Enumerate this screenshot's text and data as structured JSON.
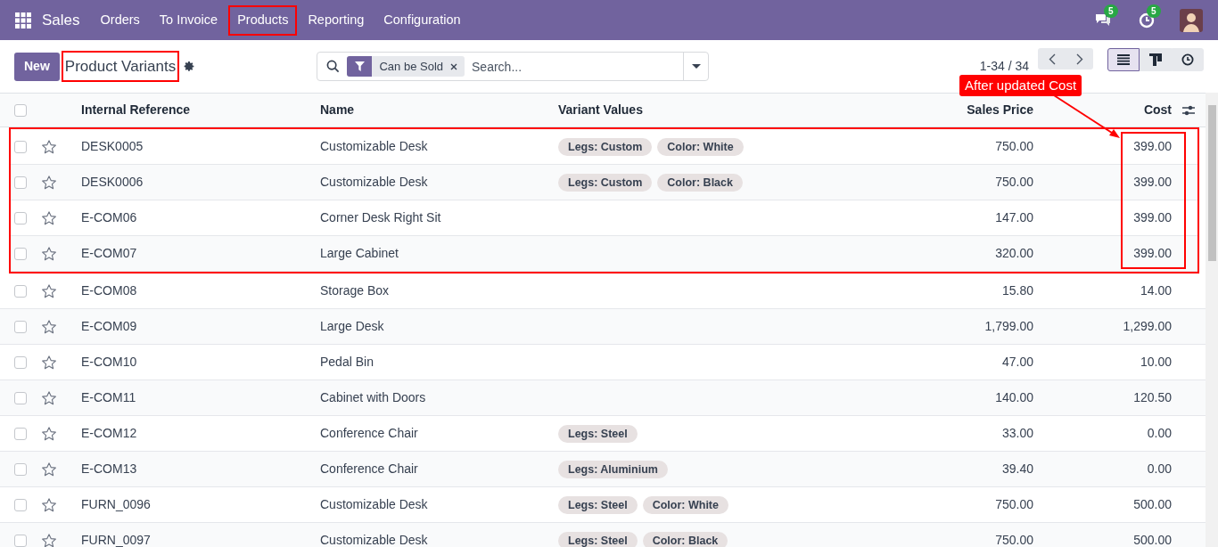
{
  "topbar": {
    "app": "Sales",
    "menu": [
      {
        "label": "Orders",
        "highlighted": false
      },
      {
        "label": "To Invoice",
        "highlighted": false
      },
      {
        "label": "Products",
        "highlighted": true
      },
      {
        "label": "Reporting",
        "highlighted": false
      },
      {
        "label": "Configuration",
        "highlighted": false
      }
    ],
    "messages_badge": "5",
    "activities_badge": "5"
  },
  "control_panel": {
    "new_button": "New",
    "title": "Product Variants",
    "title_highlighted": true,
    "search": {
      "facet": "Can be Sold",
      "placeholder": "Search..."
    },
    "pager": "1-34 / 34",
    "views": [
      {
        "kind": "list",
        "selected": true
      },
      {
        "kind": "kanban",
        "selected": false
      },
      {
        "kind": "activity",
        "selected": false
      }
    ]
  },
  "annotation": {
    "callout": "After updated Cost"
  },
  "table": {
    "select_all_checked": false,
    "columns": [
      "Internal Reference",
      "Name",
      "Variant Values",
      "Sales Price",
      "Cost"
    ],
    "rows": [
      {
        "ref": "DESK0005",
        "name": "Customizable Desk",
        "variants": [
          "Legs: Custom",
          "Color: White"
        ],
        "sales_price": "750.00",
        "cost": "399.00",
        "highlighted": true,
        "checked": false,
        "starred": false
      },
      {
        "ref": "DESK0006",
        "name": "Customizable Desk",
        "variants": [
          "Legs: Custom",
          "Color: Black"
        ],
        "sales_price": "750.00",
        "cost": "399.00",
        "highlighted": true,
        "checked": false,
        "starred": false
      },
      {
        "ref": "E-COM06",
        "name": "Corner Desk Right Sit",
        "variants": [],
        "sales_price": "147.00",
        "cost": "399.00",
        "highlighted": true,
        "checked": false,
        "starred": false
      },
      {
        "ref": "E-COM07",
        "name": "Large Cabinet",
        "variants": [],
        "sales_price": "320.00",
        "cost": "399.00",
        "highlighted": true,
        "checked": false,
        "starred": false
      },
      {
        "ref": "E-COM08",
        "name": "Storage Box",
        "variants": [],
        "sales_price": "15.80",
        "cost": "14.00",
        "highlighted": false,
        "checked": false,
        "starred": false
      },
      {
        "ref": "E-COM09",
        "name": "Large Desk",
        "variants": [],
        "sales_price": "1,799.00",
        "cost": "1,299.00",
        "highlighted": false,
        "checked": false,
        "starred": false
      },
      {
        "ref": "E-COM10",
        "name": "Pedal Bin",
        "variants": [],
        "sales_price": "47.00",
        "cost": "10.00",
        "highlighted": false,
        "checked": false,
        "starred": false
      },
      {
        "ref": "E-COM11",
        "name": "Cabinet with Doors",
        "variants": [],
        "sales_price": "140.00",
        "cost": "120.50",
        "highlighted": false,
        "checked": false,
        "starred": false
      },
      {
        "ref": "E-COM12",
        "name": "Conference Chair",
        "variants": [
          "Legs: Steel"
        ],
        "sales_price": "33.00",
        "cost": "0.00",
        "highlighted": false,
        "checked": false,
        "starred": false
      },
      {
        "ref": "E-COM13",
        "name": "Conference Chair",
        "variants": [
          "Legs: Aluminium"
        ],
        "sales_price": "39.40",
        "cost": "0.00",
        "highlighted": false,
        "checked": false,
        "starred": false
      },
      {
        "ref": "FURN_0096",
        "name": "Customizable Desk",
        "variants": [
          "Legs: Steel",
          "Color: White"
        ],
        "sales_price": "750.00",
        "cost": "500.00",
        "highlighted": false,
        "checked": false,
        "starred": false
      },
      {
        "ref": "FURN_0097",
        "name": "Customizable Desk",
        "variants": [
          "Legs: Steel",
          "Color: Black"
        ],
        "sales_price": "750.00",
        "cost": "500.00",
        "highlighted": false,
        "checked": false,
        "starred": false
      }
    ]
  }
}
